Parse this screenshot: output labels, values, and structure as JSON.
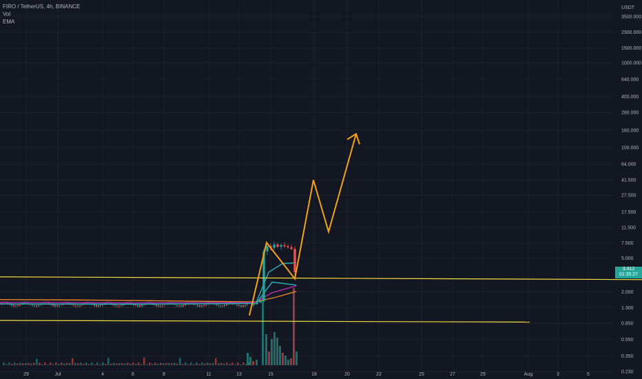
{
  "legend": {
    "symbol": "FIRO / TetherUS, 4h, BINANCE",
    "vol": "Vol",
    "ema": "EMA"
  },
  "price_tag": {
    "price": "3.412",
    "countdown": "01:35:27"
  },
  "colors": {
    "background": "#131722",
    "grid": "#1e222d",
    "axis_text": "#b2b5be",
    "up": "#26a69a",
    "down": "#ef5350",
    "projection": "#f7a21b",
    "support_lines": "#f5e042",
    "ema_teal": "#2ab3c0",
    "ema_purple": "#b72bb2",
    "ema_orange": "#e8862a"
  },
  "chart_data": {
    "type": "candlestick",
    "title": "FIRO / TetherUS, 4h, BINANCE",
    "y_unit": "USDT",
    "y_scale": "log",
    "ylim": [
      0.21,
      4900
    ],
    "y_ticks": [
      "3500.000",
      "2300.000",
      "1500.000",
      "1000.000",
      "640.000",
      "400.000",
      "260.000",
      "160.000",
      "100.000",
      "64.000",
      "41.500",
      "27.500",
      "17.500",
      "11.500",
      "7.500",
      "5.000",
      "3.412",
      "2.000",
      "1.300",
      "0.850",
      "0.550",
      "0.350",
      "0.230"
    ],
    "x_ticks": [
      "29",
      "Jul",
      "4",
      "6",
      "8",
      "11",
      "13",
      "15",
      "18",
      "20",
      "22",
      "25",
      "27",
      "29",
      "Aug",
      "3",
      "5"
    ],
    "grid": true,
    "last_price": 3.412,
    "candles": [
      {
        "date": "Jul 13 12:00",
        "open": 1.39,
        "high": 1.46,
        "low": 1.34,
        "close": 1.43
      },
      {
        "date": "Jul 13 16:00",
        "open": 1.43,
        "high": 1.52,
        "low": 1.4,
        "close": 1.5
      },
      {
        "date": "Jul 13 20:00",
        "open": 1.5,
        "high": 1.6,
        "low": 1.46,
        "close": 1.55
      },
      {
        "date": "Jul 14 00:00",
        "open": 1.55,
        "high": 6.4,
        "low": 1.52,
        "close": 6.0
      },
      {
        "date": "Jul 14 04:00",
        "open": 6.0,
        "high": 7.6,
        "low": 5.4,
        "close": 6.9
      },
      {
        "date": "Jul 14 08:00",
        "open": 6.9,
        "high": 7.4,
        "low": 6.1,
        "close": 6.6
      },
      {
        "date": "Jul 14 12:00",
        "open": 6.6,
        "high": 7.8,
        "low": 6.2,
        "close": 7.2
      },
      {
        "date": "Jul 14 16:00",
        "open": 7.2,
        "high": 7.5,
        "low": 6.5,
        "close": 6.8
      },
      {
        "date": "Jul 14 20:00",
        "open": 6.8,
        "high": 7.4,
        "low": 6.3,
        "close": 7.1
      },
      {
        "date": "Jul 15 00:00",
        "open": 7.1,
        "high": 7.7,
        "low": 6.5,
        "close": 6.9
      },
      {
        "date": "Jul 15 04:00",
        "open": 6.9,
        "high": 7.3,
        "low": 6.4,
        "close": 6.7
      },
      {
        "date": "Jul 15 08:00",
        "open": 6.7,
        "high": 7.2,
        "low": 6.2,
        "close": 6.4
      },
      {
        "date": "Jul 15 12:00",
        "open": 6.4,
        "high": 6.9,
        "low": 3.2,
        "close": 3.41
      }
    ],
    "pre_pump_range": {
      "low": 1.3,
      "high": 1.6
    },
    "volume_spikes": [
      {
        "date": "Jul 14 00:00",
        "direction": "up",
        "relative": 1.0
      },
      {
        "date": "Jul 15 12:00",
        "direction": "down",
        "relative": 0.86
      }
    ],
    "horizontal_lines": [
      {
        "name": "upper support",
        "price": 2.9
      },
      {
        "name": "lower support",
        "price": 0.88
      }
    ],
    "projection_path": [
      2.8,
      6.8,
      41.5,
      12.0,
      145.0
    ]
  }
}
